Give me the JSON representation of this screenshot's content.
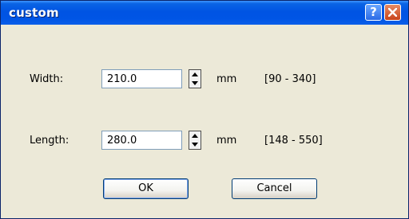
{
  "dialog": {
    "title": "custom",
    "help_symbol": "?",
    "fields": [
      {
        "label": "Width:",
        "value": "210.0",
        "unit": "mm",
        "range": "[90 - 340]"
      },
      {
        "label": "Length:",
        "value": "280.0",
        "unit": "mm",
        "range": "[148 - 550]"
      }
    ],
    "buttons": {
      "ok": "OK",
      "cancel": "Cancel"
    }
  },
  "colors": {
    "titlebar": "#0054e3",
    "close_button": "#c8431a",
    "dialog_background": "#ece9d8"
  },
  "icons": [
    "help-icon",
    "close-icon",
    "spin-up-icon",
    "spin-down-icon"
  ]
}
